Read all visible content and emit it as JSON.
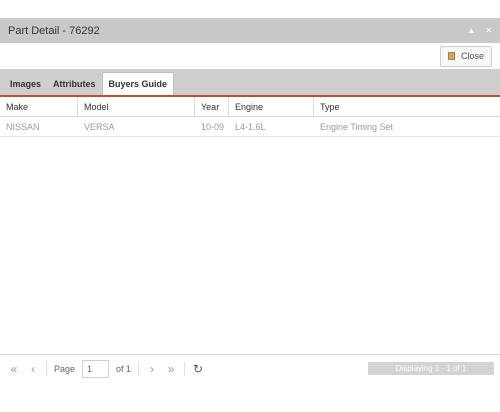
{
  "window": {
    "title": "Part Detail - 76292",
    "minimize_glyph": "▲",
    "close_glyph": "✕"
  },
  "toolbar": {
    "close_label": "Close",
    "close_icon": "document-icon"
  },
  "tabs": [
    {
      "label": "Images"
    },
    {
      "label": "Attributes"
    },
    {
      "label": "Buyers Guide",
      "active": true
    }
  ],
  "grid": {
    "columns": [
      "Make",
      "Model",
      "Year",
      "Engine",
      "Type"
    ],
    "rows": [
      [
        "NISSAN",
        "VERSA",
        "10-09",
        "L4-1.6L",
        "Engine Timing Set"
      ]
    ]
  },
  "pager": {
    "page_label": "Page",
    "page_value": "1",
    "of_label": "of 1",
    "first_icon": "«",
    "prev_icon": "‹",
    "next_icon": "›",
    "last_icon": "»",
    "refresh_icon": "↻",
    "display_text": "Displaying 1 - 1 of 1"
  },
  "colors": {
    "tab_underline": "#c24b3a",
    "titlebar": "#c9c9c9"
  }
}
